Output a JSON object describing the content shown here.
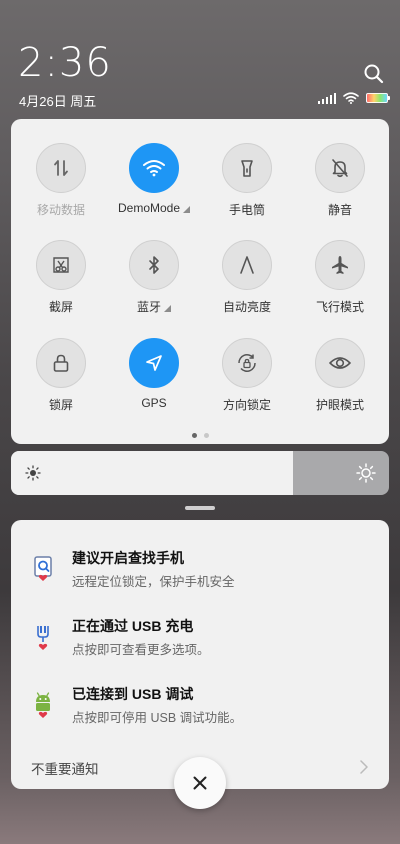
{
  "status": {
    "time": "2:36",
    "date": "4月26日 周五",
    "battery_level": "charging-multicolor"
  },
  "quick_settings": {
    "tiles": [
      {
        "id": "mobile-data",
        "label": "移动数据",
        "icon": "mobile-data-icon",
        "active": false,
        "disabled": true,
        "expandable": false
      },
      {
        "id": "wifi",
        "label": "DemoMode",
        "icon": "wifi-icon",
        "active": true,
        "disabled": false,
        "expandable": true
      },
      {
        "id": "flashlight",
        "label": "手电筒",
        "icon": "flashlight-icon",
        "active": false,
        "disabled": false,
        "expandable": false
      },
      {
        "id": "mute",
        "label": "静音",
        "icon": "bell-off-icon",
        "active": false,
        "disabled": false,
        "expandable": false
      },
      {
        "id": "screenshot",
        "label": "截屏",
        "icon": "screenshot-icon",
        "active": false,
        "disabled": false,
        "expandable": false
      },
      {
        "id": "bluetooth",
        "label": "蓝牙",
        "icon": "bluetooth-icon",
        "active": false,
        "disabled": false,
        "expandable": true
      },
      {
        "id": "auto-brightness",
        "label": "自动亮度",
        "icon": "auto-brightness-icon",
        "active": false,
        "disabled": false,
        "expandable": false
      },
      {
        "id": "airplane",
        "label": "飞行模式",
        "icon": "airplane-icon",
        "active": false,
        "disabled": false,
        "expandable": false
      },
      {
        "id": "lock-screen",
        "label": "锁屏",
        "icon": "lock-icon",
        "active": false,
        "disabled": false,
        "expandable": false
      },
      {
        "id": "gps",
        "label": "GPS",
        "icon": "location-arrow-icon",
        "active": true,
        "disabled": false,
        "expandable": false
      },
      {
        "id": "rotation-lock",
        "label": "方向锁定",
        "icon": "rotation-lock-icon",
        "active": false,
        "disabled": false,
        "expandable": false
      },
      {
        "id": "eye-care",
        "label": "护眼模式",
        "icon": "eye-icon",
        "active": false,
        "disabled": false,
        "expandable": false
      }
    ],
    "page_count": 2,
    "current_page": 1
  },
  "brightness": {
    "level": 0.745
  },
  "notifications": [
    {
      "title": "建议开启查找手机",
      "body": "远程定位锁定，保护手机安全",
      "icon": "find-phone-icon"
    },
    {
      "title": "正在通过 USB 充电",
      "body": "点按即可查看更多选项。",
      "icon": "usb-icon"
    },
    {
      "title": "已连接到 USB 调试",
      "body": "点按即可停用 USB 调试功能。",
      "icon": "android-debug-icon"
    }
  ],
  "unimportant_label": "不重要通知",
  "colors": {
    "active_tile": "#1e96f5",
    "panel_bg": "#f1f1f1"
  }
}
